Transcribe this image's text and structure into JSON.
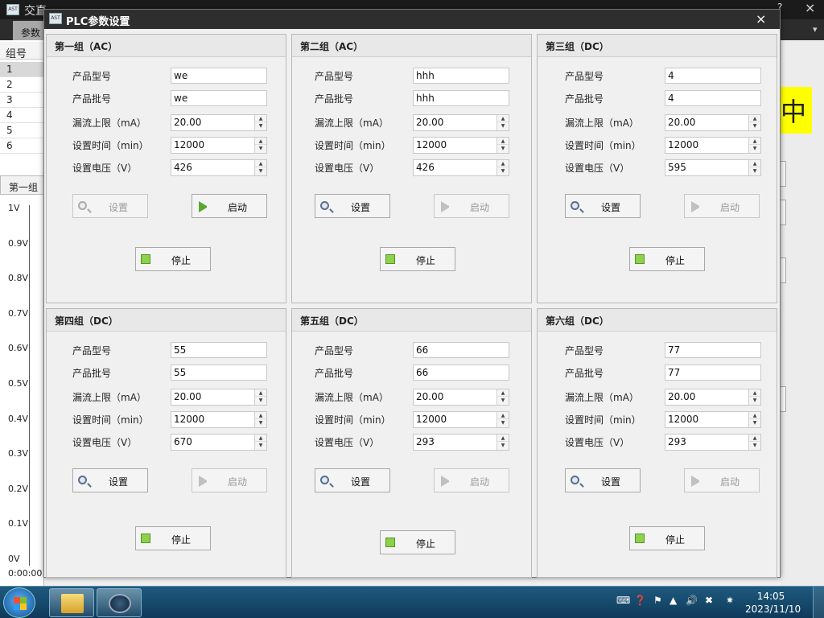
{
  "background_app": {
    "title": "交直",
    "title_right": "?",
    "title_close": "×",
    "tab": "参数",
    "table_header": "组号",
    "table_rows": [
      "1",
      "2",
      "3",
      "4",
      "5",
      "6"
    ],
    "group_tab": "第一组",
    "y_ticks": [
      "1V",
      "0.9V",
      "0.8V",
      "0.7V",
      "0.6V",
      "0.5V",
      "0.4V",
      "0.3V",
      "0.2V",
      "0.1V",
      "0V"
    ],
    "x_start": "0:00:00",
    "right_status_char": "中"
  },
  "dialog": {
    "title": "PLC参数设置",
    "close": "×",
    "labels": {
      "model": "产品型号",
      "batch": "产品批号",
      "leak": "漏流上限（mA）",
      "time": "设置时间（min）",
      "voltage": "设置电压（V）",
      "set": "设置",
      "start": "启动",
      "stop": "停止"
    },
    "groups": [
      {
        "title": "第一组（AC）",
        "model": "we",
        "batch": "we",
        "leak": "20.00",
        "time": "12000",
        "voltage": "426",
        "set_enabled": false,
        "start_enabled": true
      },
      {
        "title": "第二组（AC）",
        "model": "hhh",
        "batch": "hhh",
        "leak": "20.00",
        "time": "12000",
        "voltage": "426",
        "set_enabled": true,
        "start_enabled": false
      },
      {
        "title": "第三组（DC）",
        "model": "4",
        "batch": "4",
        "leak": "20.00",
        "time": "12000",
        "voltage": "595",
        "set_enabled": true,
        "start_enabled": false
      },
      {
        "title": "第四组（DC）",
        "model": "55",
        "batch": "55",
        "leak": "20.00",
        "time": "12000",
        "voltage": "670",
        "set_enabled": true,
        "start_enabled": false
      },
      {
        "title": "第五组（DC）",
        "model": "66",
        "batch": "66",
        "leak": "20.00",
        "time": "12000",
        "voltage": "293",
        "set_enabled": true,
        "start_enabled": false
      },
      {
        "title": "第六组（DC）",
        "model": "77",
        "batch": "77",
        "leak": "20.00",
        "time": "12000",
        "voltage": "293",
        "set_enabled": true,
        "start_enabled": false
      }
    ]
  },
  "taskbar": {
    "time": "14:05",
    "date": "2023/11/10"
  }
}
